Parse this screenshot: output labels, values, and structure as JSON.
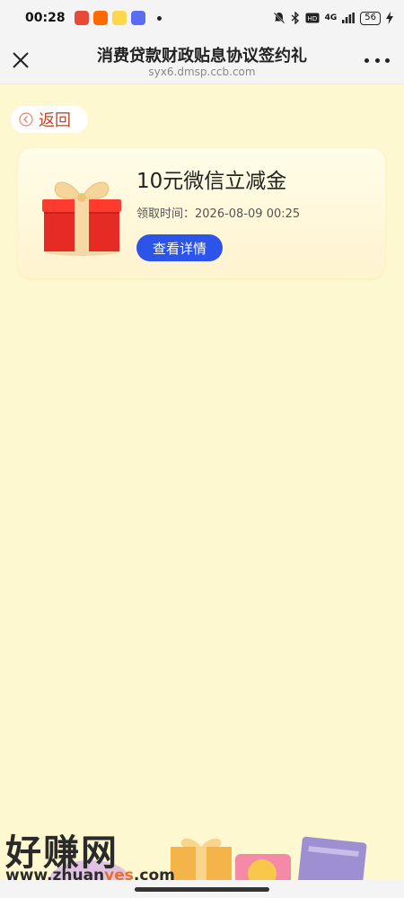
{
  "status_bar": {
    "time": "00:28",
    "battery": "56",
    "network": "4G"
  },
  "header": {
    "title": "消费贷款财政贴息协议签约礼",
    "url": "syx6.dmsp.ccb.com"
  },
  "back_button": {
    "label": "返回"
  },
  "reward_card": {
    "title": "10元微信立减金",
    "time_label": "领取时间：",
    "time_value": "2026-08-09 00:25",
    "detail_button": "查看详情"
  },
  "watermark": {
    "text": "好赚网",
    "url_prefix": "www.zhuan",
    "url_highlight": "yes",
    "url_suffix": ".com"
  },
  "colors": {
    "background": "#fdf8cf",
    "accent_blue": "#2d54e8",
    "back_red": "#c6462a"
  }
}
